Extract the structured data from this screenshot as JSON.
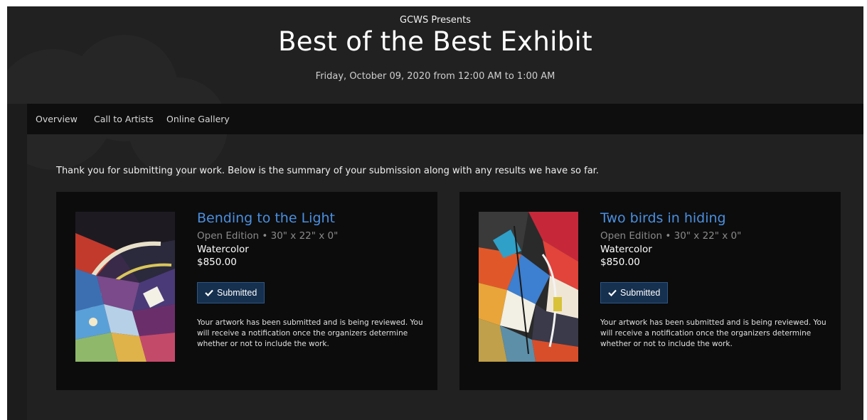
{
  "header": {
    "presenter": "GCWS Presents",
    "title": "Best of the Best Exhibit",
    "date": "Friday, October 09, 2020 from 12:00 AM to 1:00 AM"
  },
  "nav": {
    "items": [
      {
        "label": "Overview"
      },
      {
        "label": "Call to Artists"
      },
      {
        "label": "Online Gallery"
      }
    ]
  },
  "intro": "Thank you for submitting your work. Below is the summary of your submission along with any results we have so far.",
  "submissions": [
    {
      "title": "Bending to the Light",
      "edition": "Open Edition • 30\" x 22\" x 0\"",
      "medium": "Watercolor",
      "price": "$850.00",
      "status": "Submitted",
      "status_icon": "check-icon",
      "note": "Your artwork has been submitted and is being reviewed. You will receive a notification once the organizers determine whether or not to include the work."
    },
    {
      "title": "Two birds in hiding",
      "edition": "Open Edition • 30\" x 22\" x 0\"",
      "medium": "Watercolor",
      "price": "$850.00",
      "status": "Submitted",
      "status_icon": "check-icon",
      "note": "Your artwork has been submitted and is being reviewed. You will receive a notification once the organizers determine whether or not to include the work."
    }
  ],
  "colors": {
    "background": "#212121",
    "nav_bar": "#0e0e0e",
    "card": "#0c0c0c",
    "title_link": "#4a8fe0",
    "status_button": "#16304f"
  }
}
